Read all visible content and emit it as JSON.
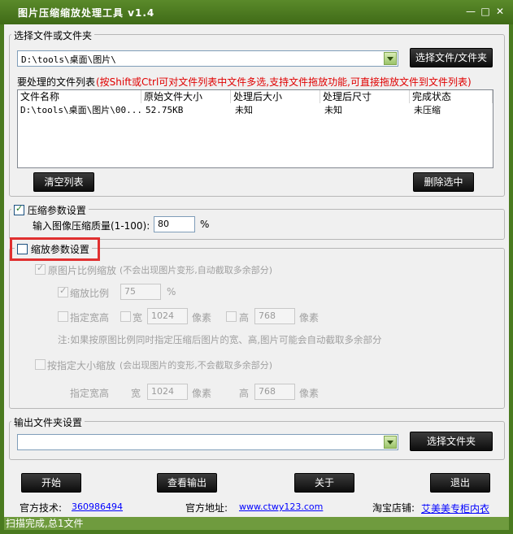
{
  "window": {
    "title": "图片压缩缩放处理工具 v1.4"
  },
  "select_group": {
    "legend": "选择文件或文件夹",
    "path_value": "D:\\tools\\桌面\\图片\\",
    "select_button": "选择文件/文件夹",
    "list_label": "要处理的文件列表",
    "hint": "(按Shift或Ctrl可对文件列表中文件多选,支持文件拖放功能,可直接拖放文件到文件列表)",
    "columns": [
      "文件名称",
      "原始文件大小",
      "处理后大小",
      "处理后尺寸",
      "完成状态"
    ],
    "rows": [
      [
        "D:\\tools\\桌面\\图片\\00...",
        "52.75KB",
        "未知",
        "未知",
        "未压缩"
      ]
    ],
    "clear_button": "清空列表",
    "delete_button": "删除选中"
  },
  "compress_group": {
    "legend": "压缩参数设置",
    "checked": true,
    "quality_label": "输入图像压缩质量(1-100):",
    "quality_value": "80",
    "quality_unit": "%"
  },
  "scale_group": {
    "legend": "缩放参数设置",
    "checked": false,
    "proportional_label": "原图片比例缩放",
    "proportional_note": "(不会出现图片变形,自动截取多余部分)",
    "ratio_label": "缩放比例",
    "ratio_value": "75",
    "ratio_unit": "%",
    "fixed_wh_label": "指定宽高",
    "width_label": "宽",
    "width_value": "1024",
    "width_unit": "像素",
    "height_label": "高",
    "height_value": "768",
    "height_unit": "像素",
    "note": "注:如果按原图比例同时指定压缩后图片的宽、高,图片可能会自动截取多余部分",
    "fixed_size_label": "按指定大小缩放",
    "fixed_size_note": "(会出现图片的变形,不会截取多余部分)",
    "fixed_wh_label2": "指定宽高",
    "width_label2": "宽",
    "width_value2": "1024",
    "width_unit2": "像素",
    "height_label2": "高",
    "height_value2": "768",
    "height_unit2": "像素"
  },
  "output_group": {
    "legend": "输出文件夹设置",
    "path_value": "",
    "select_button": "选择文件夹"
  },
  "bottom_buttons": {
    "start": "开始",
    "view_output": "查看输出",
    "about": "关于",
    "exit": "退出"
  },
  "footer": {
    "tech_label": "官方技术:",
    "tech_value": "360986494",
    "site_label": "官方地址:",
    "site_value": "www.ctwy123.com",
    "shop_label": "淘宝店铺:",
    "shop_value": "艾美美专柜内衣"
  },
  "status": "扫描完成,总1文件",
  "colors": {
    "titlebar": "#4a7a1f",
    "statusbar": "#6f9b3e",
    "highlight": "#e03030",
    "hint": "#e00000"
  }
}
